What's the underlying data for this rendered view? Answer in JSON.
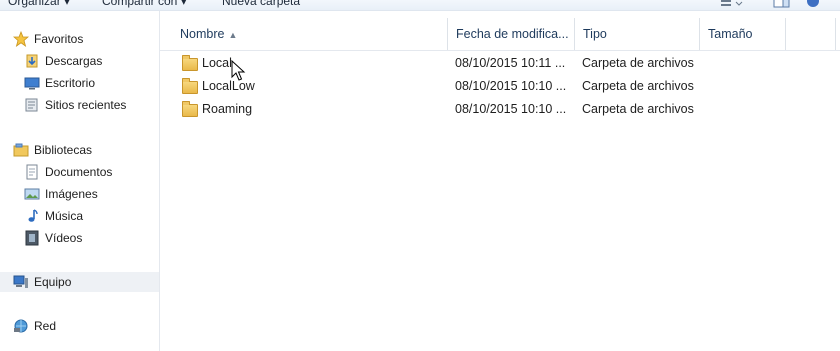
{
  "toolbar": {
    "organize": "Organizar ▾",
    "share": "Compartir con ▾",
    "new_folder": "Nueva carpeta"
  },
  "sidebar": {
    "favorites": {
      "label": "Favoritos",
      "items": [
        {
          "label": "Descargas",
          "icon": "downloads-icon"
        },
        {
          "label": "Escritorio",
          "icon": "desktop-icon"
        },
        {
          "label": "Sitios recientes",
          "icon": "recent-places-icon"
        }
      ]
    },
    "libraries": {
      "label": "Bibliotecas",
      "items": [
        {
          "label": "Documentos",
          "icon": "documents-icon"
        },
        {
          "label": "Imágenes",
          "icon": "pictures-icon"
        },
        {
          "label": "Música",
          "icon": "music-icon"
        },
        {
          "label": "Vídeos",
          "icon": "videos-icon"
        }
      ]
    },
    "computer": {
      "label": "Equipo"
    },
    "network": {
      "label": "Red"
    }
  },
  "columns": {
    "name": "Nombre",
    "date": "Fecha de modifica...",
    "type": "Tipo",
    "size": "Tamaño"
  },
  "files": [
    {
      "name": "Local",
      "date": "08/10/2015 10:11 ...",
      "type": "Carpeta de archivos",
      "size": ""
    },
    {
      "name": "LocalLow",
      "date": "08/10/2015 10:10 ...",
      "type": "Carpeta de archivos",
      "size": ""
    },
    {
      "name": "Roaming",
      "date": "08/10/2015 10:10 ...",
      "type": "Carpeta de archivos",
      "size": ""
    }
  ],
  "colors": {
    "header_text": "#1e3a5c",
    "selected_nav_bg": "#eef1f5",
    "folder_yellow": "#e9b94b"
  }
}
